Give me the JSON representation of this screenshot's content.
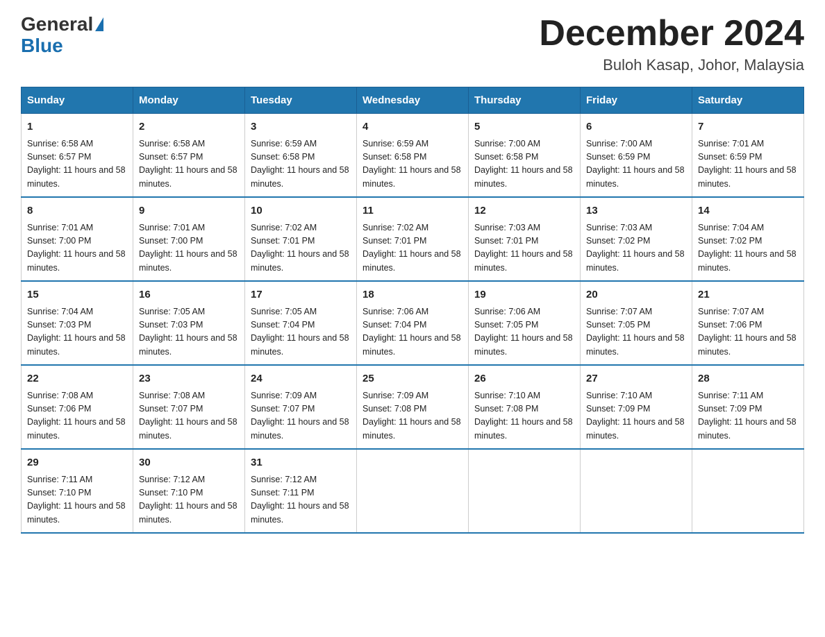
{
  "header": {
    "logo_general": "General",
    "logo_blue": "Blue",
    "title": "December 2024",
    "subtitle": "Buloh Kasap, Johor, Malaysia"
  },
  "days_of_week": [
    "Sunday",
    "Monday",
    "Tuesday",
    "Wednesday",
    "Thursday",
    "Friday",
    "Saturday"
  ],
  "weeks": [
    [
      {
        "day": "1",
        "sunrise": "6:58 AM",
        "sunset": "6:57 PM",
        "daylight": "11 hours and 58 minutes."
      },
      {
        "day": "2",
        "sunrise": "6:58 AM",
        "sunset": "6:57 PM",
        "daylight": "11 hours and 58 minutes."
      },
      {
        "day": "3",
        "sunrise": "6:59 AM",
        "sunset": "6:58 PM",
        "daylight": "11 hours and 58 minutes."
      },
      {
        "day": "4",
        "sunrise": "6:59 AM",
        "sunset": "6:58 PM",
        "daylight": "11 hours and 58 minutes."
      },
      {
        "day": "5",
        "sunrise": "7:00 AM",
        "sunset": "6:58 PM",
        "daylight": "11 hours and 58 minutes."
      },
      {
        "day": "6",
        "sunrise": "7:00 AM",
        "sunset": "6:59 PM",
        "daylight": "11 hours and 58 minutes."
      },
      {
        "day": "7",
        "sunrise": "7:01 AM",
        "sunset": "6:59 PM",
        "daylight": "11 hours and 58 minutes."
      }
    ],
    [
      {
        "day": "8",
        "sunrise": "7:01 AM",
        "sunset": "7:00 PM",
        "daylight": "11 hours and 58 minutes."
      },
      {
        "day": "9",
        "sunrise": "7:01 AM",
        "sunset": "7:00 PM",
        "daylight": "11 hours and 58 minutes."
      },
      {
        "day": "10",
        "sunrise": "7:02 AM",
        "sunset": "7:01 PM",
        "daylight": "11 hours and 58 minutes."
      },
      {
        "day": "11",
        "sunrise": "7:02 AM",
        "sunset": "7:01 PM",
        "daylight": "11 hours and 58 minutes."
      },
      {
        "day": "12",
        "sunrise": "7:03 AM",
        "sunset": "7:01 PM",
        "daylight": "11 hours and 58 minutes."
      },
      {
        "day": "13",
        "sunrise": "7:03 AM",
        "sunset": "7:02 PM",
        "daylight": "11 hours and 58 minutes."
      },
      {
        "day": "14",
        "sunrise": "7:04 AM",
        "sunset": "7:02 PM",
        "daylight": "11 hours and 58 minutes."
      }
    ],
    [
      {
        "day": "15",
        "sunrise": "7:04 AM",
        "sunset": "7:03 PM",
        "daylight": "11 hours and 58 minutes."
      },
      {
        "day": "16",
        "sunrise": "7:05 AM",
        "sunset": "7:03 PM",
        "daylight": "11 hours and 58 minutes."
      },
      {
        "day": "17",
        "sunrise": "7:05 AM",
        "sunset": "7:04 PM",
        "daylight": "11 hours and 58 minutes."
      },
      {
        "day": "18",
        "sunrise": "7:06 AM",
        "sunset": "7:04 PM",
        "daylight": "11 hours and 58 minutes."
      },
      {
        "day": "19",
        "sunrise": "7:06 AM",
        "sunset": "7:05 PM",
        "daylight": "11 hours and 58 minutes."
      },
      {
        "day": "20",
        "sunrise": "7:07 AM",
        "sunset": "7:05 PM",
        "daylight": "11 hours and 58 minutes."
      },
      {
        "day": "21",
        "sunrise": "7:07 AM",
        "sunset": "7:06 PM",
        "daylight": "11 hours and 58 minutes."
      }
    ],
    [
      {
        "day": "22",
        "sunrise": "7:08 AM",
        "sunset": "7:06 PM",
        "daylight": "11 hours and 58 minutes."
      },
      {
        "day": "23",
        "sunrise": "7:08 AM",
        "sunset": "7:07 PM",
        "daylight": "11 hours and 58 minutes."
      },
      {
        "day": "24",
        "sunrise": "7:09 AM",
        "sunset": "7:07 PM",
        "daylight": "11 hours and 58 minutes."
      },
      {
        "day": "25",
        "sunrise": "7:09 AM",
        "sunset": "7:08 PM",
        "daylight": "11 hours and 58 minutes."
      },
      {
        "day": "26",
        "sunrise": "7:10 AM",
        "sunset": "7:08 PM",
        "daylight": "11 hours and 58 minutes."
      },
      {
        "day": "27",
        "sunrise": "7:10 AM",
        "sunset": "7:09 PM",
        "daylight": "11 hours and 58 minutes."
      },
      {
        "day": "28",
        "sunrise": "7:11 AM",
        "sunset": "7:09 PM",
        "daylight": "11 hours and 58 minutes."
      }
    ],
    [
      {
        "day": "29",
        "sunrise": "7:11 AM",
        "sunset": "7:10 PM",
        "daylight": "11 hours and 58 minutes."
      },
      {
        "day": "30",
        "sunrise": "7:12 AM",
        "sunset": "7:10 PM",
        "daylight": "11 hours and 58 minutes."
      },
      {
        "day": "31",
        "sunrise": "7:12 AM",
        "sunset": "7:11 PM",
        "daylight": "11 hours and 58 minutes."
      },
      null,
      null,
      null,
      null
    ]
  ]
}
